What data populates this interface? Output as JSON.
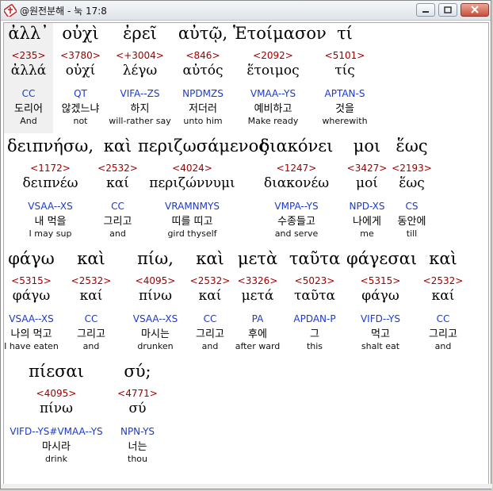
{
  "window": {
    "title": "@원전분해 - 눅 17:8",
    "icon": "book-cross-icon"
  },
  "rows": [
    {
      "words": [
        {
          "greek": "ἀλλ᾽",
          "strong": "<235>",
          "lemma": "ἀλλά",
          "parse": "CC",
          "korean": "도리어",
          "english": "And"
        },
        {
          "greek": "οὐχὶ",
          "strong": "<3780>",
          "lemma": "οὐχί",
          "parse": "QT",
          "korean": "않겠느냐",
          "english": "not"
        },
        {
          "greek": "ἐρεῖ",
          "strong": "<+3004>",
          "lemma": "λέγω",
          "parse": "VIFA--ZS",
          "korean": "하지",
          "english": "will-rather say"
        },
        {
          "greek": "αὐτῷ,",
          "strong": "<846>",
          "lemma": "αὐτός",
          "parse": "NPDMZS",
          "korean": "저더러",
          "english": "unto him"
        },
        {
          "greek": "Ἑτοίμασον",
          "strong": "<2092>",
          "lemma": "ἕτοιμος",
          "parse": "VMAA--YS",
          "korean": "예비하고",
          "english": "Make ready"
        },
        {
          "greek": "τί",
          "strong": "<5101>",
          "lemma": "τίς",
          "parse": "APTAN-S",
          "korean": "것을",
          "english": "wherewith"
        }
      ]
    },
    {
      "words": [
        {
          "greek": "δειπνήσω,",
          "strong": "<1172>",
          "lemma": "δειπνέω",
          "parse": "VSAA--XS",
          "korean": "내 먹을",
          "english": "I may sup"
        },
        {
          "greek": "καὶ",
          "strong": "<2532>",
          "lemma": "καί",
          "parse": "CC",
          "korean": "그리고",
          "english": "and"
        },
        {
          "greek": "περιζωσάμενος",
          "strong": "<4024>",
          "lemma": "περιζώννυμι",
          "parse": "VRAMNMYS",
          "korean": "띠를 띠고",
          "english": "gird thyself"
        },
        {
          "greek": "διακόνει",
          "strong": "<1247>",
          "lemma": "διακονέω",
          "parse": "VMPA--YS",
          "korean": "수종들고",
          "english": "and serve"
        },
        {
          "greek": "μοι",
          "strong": "<3427>",
          "lemma": "μοί",
          "parse": "NPD-XS",
          "korean": "나에게",
          "english": "me"
        },
        {
          "greek": "ἕως",
          "strong": "<2193>",
          "lemma": "ἕως",
          "parse": "CS",
          "korean": "동안에",
          "english": "till"
        }
      ]
    },
    {
      "words": [
        {
          "greek": "φάγω",
          "strong": "<5315>",
          "lemma": "φάγω",
          "parse": "VSAA--XS",
          "korean": "나의 먹고",
          "english": "I have eaten"
        },
        {
          "greek": "καὶ",
          "strong": "<2532>",
          "lemma": "καί",
          "parse": "CC",
          "korean": "그리고",
          "english": "and"
        },
        {
          "greek": "πίω,",
          "strong": "<4095>",
          "lemma": "πίνω",
          "parse": "VSAA--XS",
          "korean": "마시는",
          "english": "drunken"
        },
        {
          "greek": "καὶ",
          "strong": "<2532>",
          "lemma": "καί",
          "parse": "CC",
          "korean": "그리고",
          "english": "and"
        },
        {
          "greek": "μετὰ",
          "strong": "<3326>",
          "lemma": "μετά",
          "parse": "PA",
          "korean": "후에",
          "english": "after ward"
        },
        {
          "greek": "ταῦτα",
          "strong": "<5023>",
          "lemma": "ταῦτα",
          "parse": "APDAN-P",
          "korean": "그",
          "english": "this"
        },
        {
          "greek": "φάγεσαι",
          "strong": "<5315>",
          "lemma": "φάγω",
          "parse": "VIFD--YS",
          "korean": "먹고",
          "english": "shalt eat"
        },
        {
          "greek": "καὶ",
          "strong": "<2532>",
          "lemma": "καί",
          "parse": "CC",
          "korean": "그리고",
          "english": "and"
        }
      ]
    },
    {
      "words": [
        {
          "greek": "πίεσαι",
          "strong": "<4095>",
          "lemma": "πίνω",
          "parse": "VIFD--YS#VMAA--YS",
          "korean": "마시라",
          "english": "drink"
        },
        {
          "greek": "σύ;",
          "strong": "<4771>",
          "lemma": "σύ",
          "parse": "NPN-YS",
          "korean": "너는",
          "english": "thou"
        }
      ]
    }
  ]
}
